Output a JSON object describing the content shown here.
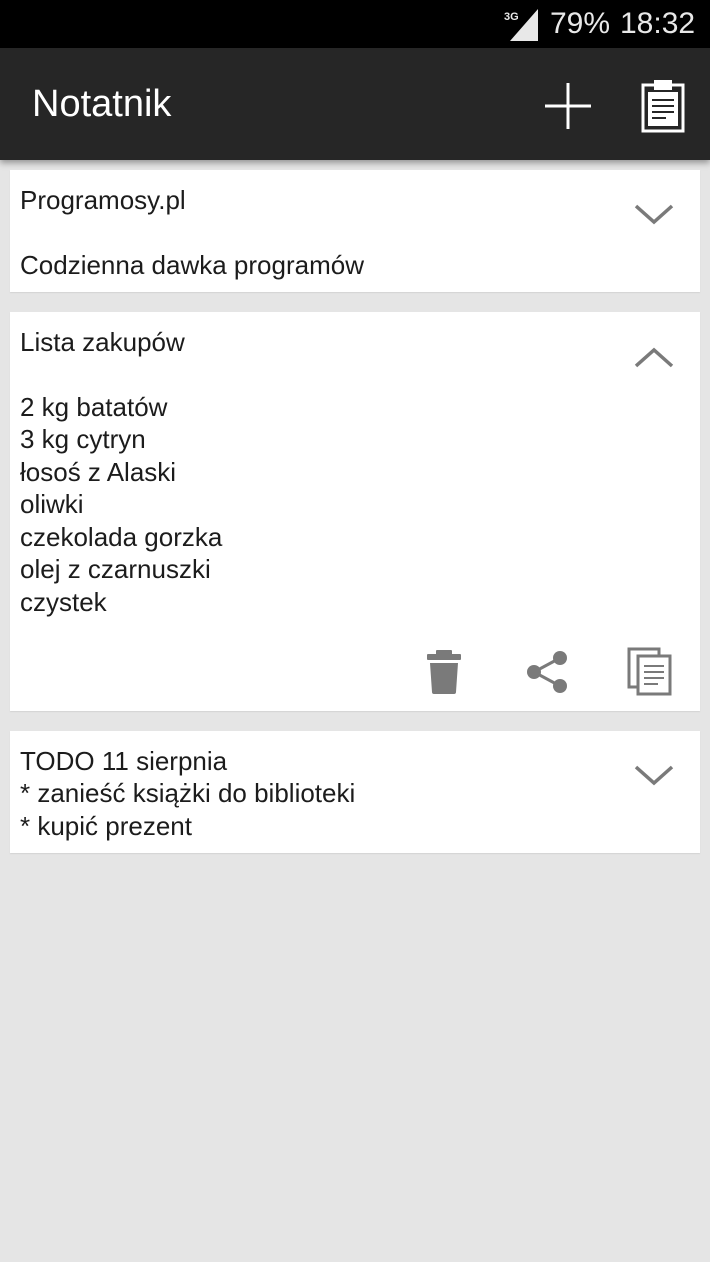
{
  "status_bar": {
    "network_label": "3G",
    "battery": "79%",
    "time": "18:32"
  },
  "action_bar": {
    "title": "Notatnik",
    "icons": [
      "add-icon",
      "clipboard-icon"
    ]
  },
  "notes": [
    {
      "title": "Programosy.pl",
      "lines": [
        "Codzienna dawka programów"
      ],
      "expanded": false
    },
    {
      "title": "Lista zakupów",
      "lines": [
        "2 kg batatów",
        "3 kg cytryn",
        "łosoś z Alaski",
        "oliwki",
        "czekolada gorzka",
        "olej z czarnuszki",
        "czystek"
      ],
      "expanded": true,
      "actions": [
        "delete-icon",
        "share-icon",
        "copy-icon"
      ]
    },
    {
      "title": "TODO 11 sierpnia",
      "lines": [
        "* zanieść książki do biblioteki",
        "* kupić prezent"
      ],
      "expanded": false
    }
  ],
  "colors": {
    "status_bar": "#000000",
    "action_bar": "#262626",
    "background": "#e5e5e5",
    "card": "#ffffff",
    "icon_gray": "#7a7a7a"
  }
}
